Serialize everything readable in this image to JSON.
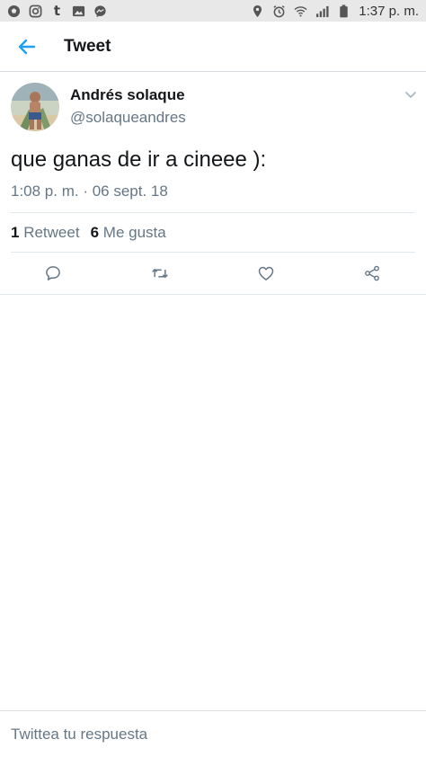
{
  "status_bar": {
    "left_icons": [
      "soccer-ball-icon",
      "instagram-icon",
      "tumblr-icon",
      "gallery-icon",
      "messenger-icon"
    ],
    "right_icons": [
      "location-icon",
      "alarm-icon",
      "wifi-icon",
      "signal-icon",
      "battery-icon"
    ],
    "time": "1:37 p. m."
  },
  "header": {
    "title": "Tweet",
    "accent_color": "#1da1f2"
  },
  "tweet": {
    "author_name": "Andrés solaque",
    "author_handle": "@solaqueandres",
    "text": "que ganas de ir a cineee ):",
    "timestamp": "1:08 p. m. · 06 sept. 18",
    "retweet_count": "1",
    "retweet_label": "Retweet",
    "like_count": "6",
    "like_label": "Me gusta"
  },
  "actions": [
    "reply-icon",
    "retweet-icon",
    "like-icon",
    "share-icon"
  ],
  "reply": {
    "placeholder": "Twittea tu respuesta"
  },
  "colors": {
    "text_primary": "#14171a",
    "text_secondary": "#657786",
    "divider": "#e1e8ed"
  }
}
